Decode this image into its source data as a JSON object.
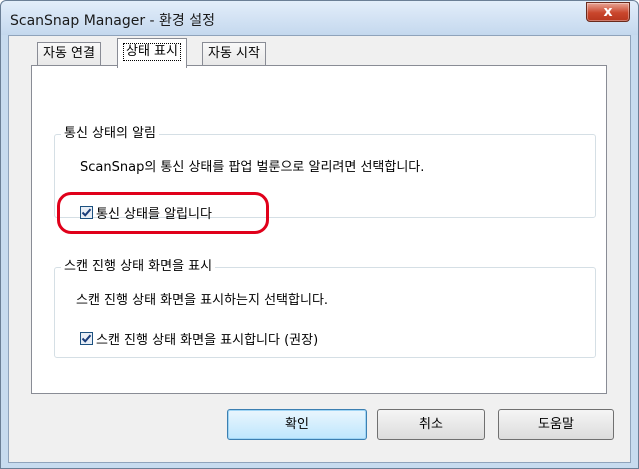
{
  "window": {
    "title": "ScanSnap Manager - 환경 설정",
    "close_label": "x"
  },
  "tabs": [
    {
      "label": "자동 연결",
      "active": false
    },
    {
      "label": "상태 표시",
      "active": true
    },
    {
      "label": "자동 시작",
      "active": false
    }
  ],
  "notify_group": {
    "legend": "통신 상태의 알림",
    "description": "ScanSnap의 통신 상태를 팝업 벌룬으로 알리려면 선택합니다.",
    "checkbox_label": "통신 상태를 알립니다",
    "checked": true
  },
  "progress_group": {
    "legend": "스캔 진행 상태 화면을 표시",
    "description": "스캔 진행 상태 화면을 표시하는지 선택합니다.",
    "checkbox_label": "스캔 진행 상태 화면을 표시합니다 (권장)",
    "checked": true
  },
  "buttons": {
    "ok": "확인",
    "cancel": "취소",
    "help": "도움말"
  },
  "colors": {
    "highlight": "#e0001a",
    "title_bar": "#c4d8ee"
  }
}
